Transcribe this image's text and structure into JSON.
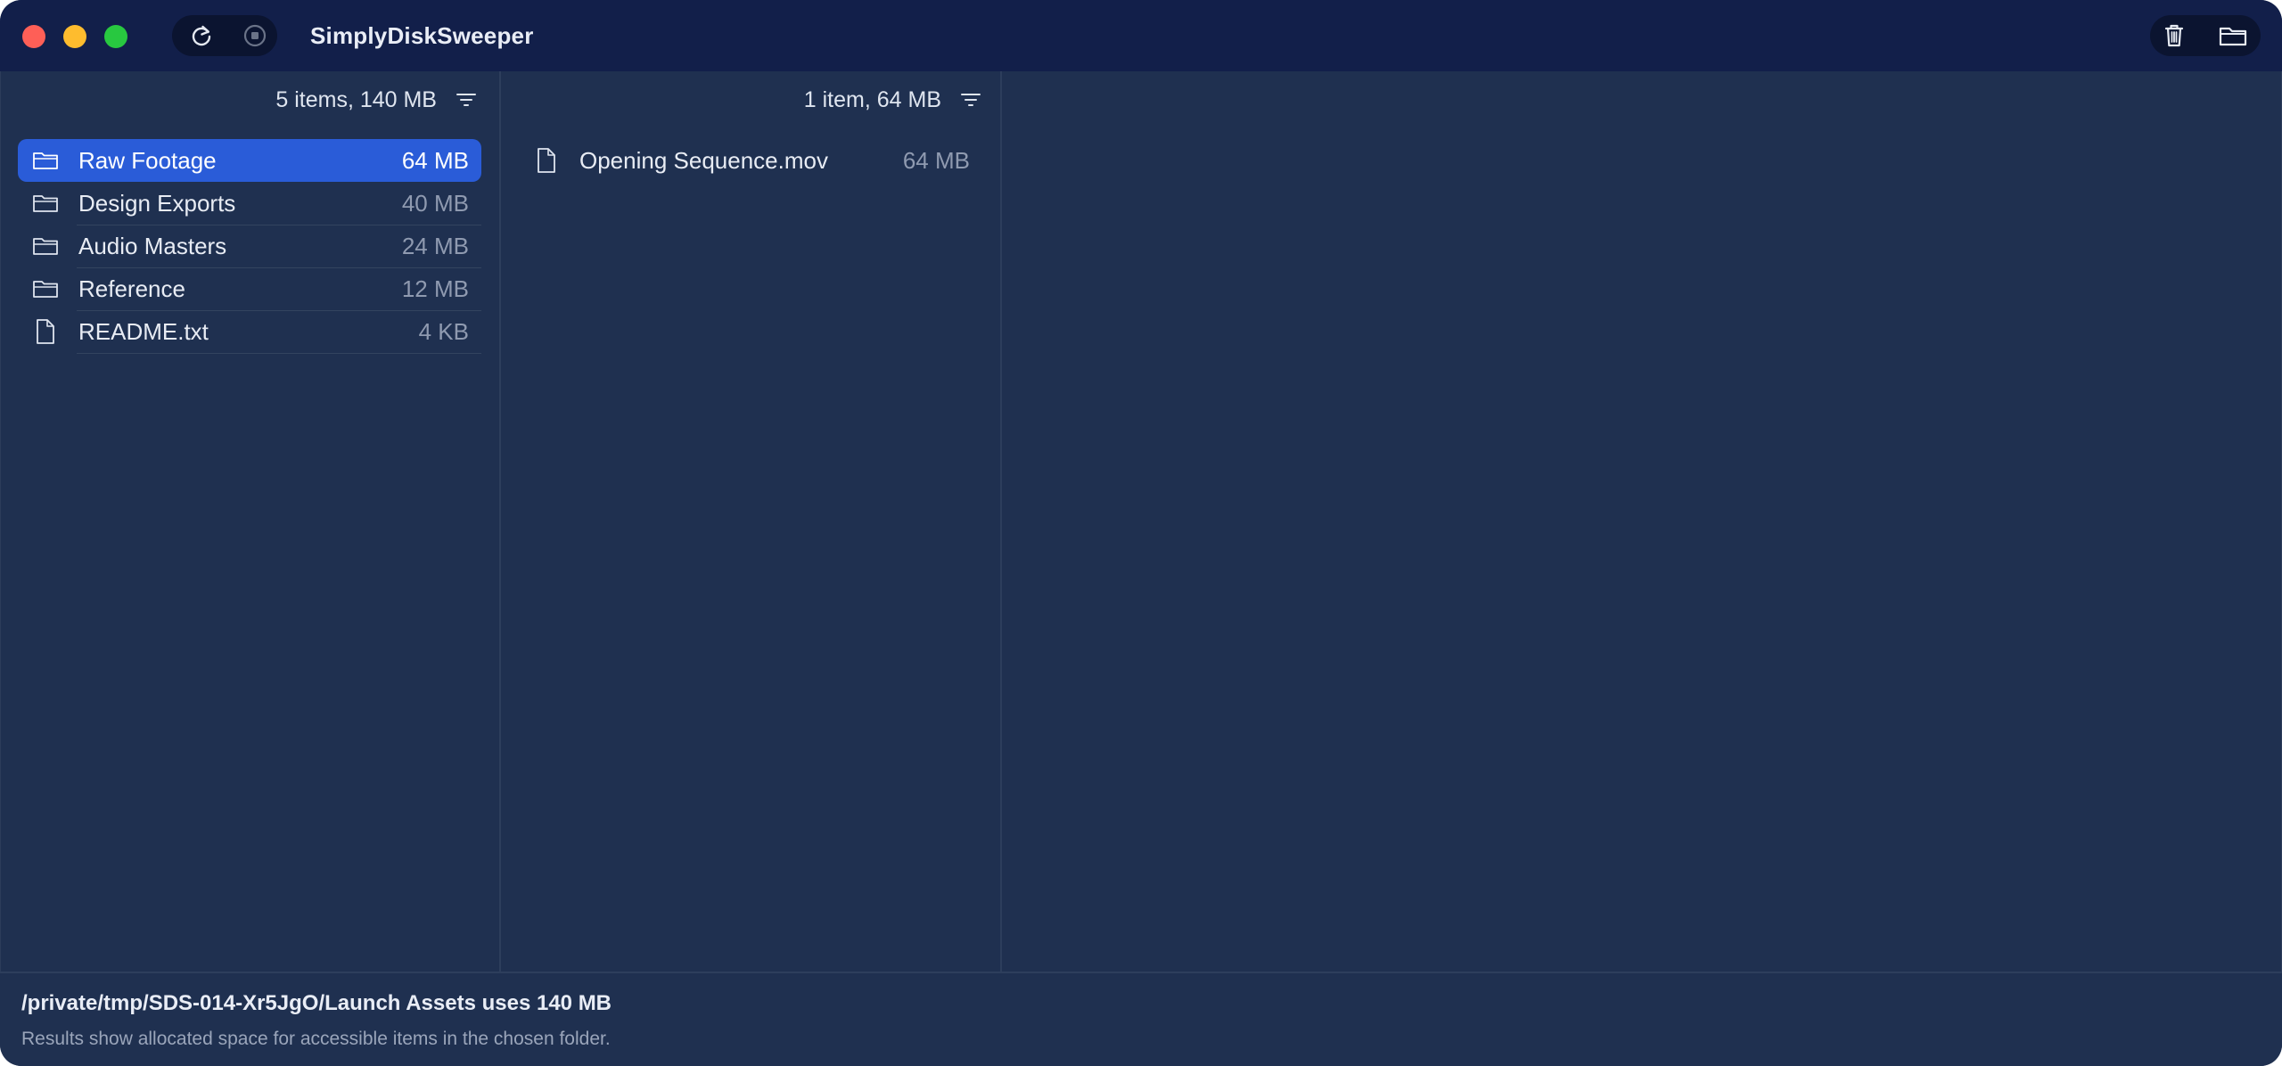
{
  "app": {
    "title": "SimplyDiskSweeper"
  },
  "toolbar": {
    "left_icons": [
      "refresh-icon",
      "stop-icon"
    ],
    "right_icons": [
      "trash-icon",
      "folder-icon"
    ]
  },
  "columns": [
    {
      "summary": "5 items, 140 MB",
      "items": [
        {
          "name": "Raw Footage",
          "size": "64 MB",
          "kind": "folder",
          "selected": true
        },
        {
          "name": "Design Exports",
          "size": "40 MB",
          "kind": "folder",
          "selected": false
        },
        {
          "name": "Audio Masters",
          "size": "24 MB",
          "kind": "folder",
          "selected": false
        },
        {
          "name": "Reference",
          "size": "12 MB",
          "kind": "folder",
          "selected": false
        },
        {
          "name": "README.txt",
          "size": "4 KB",
          "kind": "file",
          "selected": false
        }
      ]
    },
    {
      "summary": "1 item, 64 MB",
      "items": [
        {
          "name": "Opening Sequence.mov",
          "size": "64 MB",
          "kind": "file",
          "selected": false
        }
      ]
    }
  ],
  "status": {
    "path_usage": "/private/tmp/SDS-014-Xr5JgO/Launch Assets uses 140 MB",
    "note": "Results show allocated space for accessible items in the chosen folder."
  },
  "colors": {
    "background": "#1f3050",
    "titlebar": "#121f4a",
    "selection": "#2a5cd8"
  }
}
